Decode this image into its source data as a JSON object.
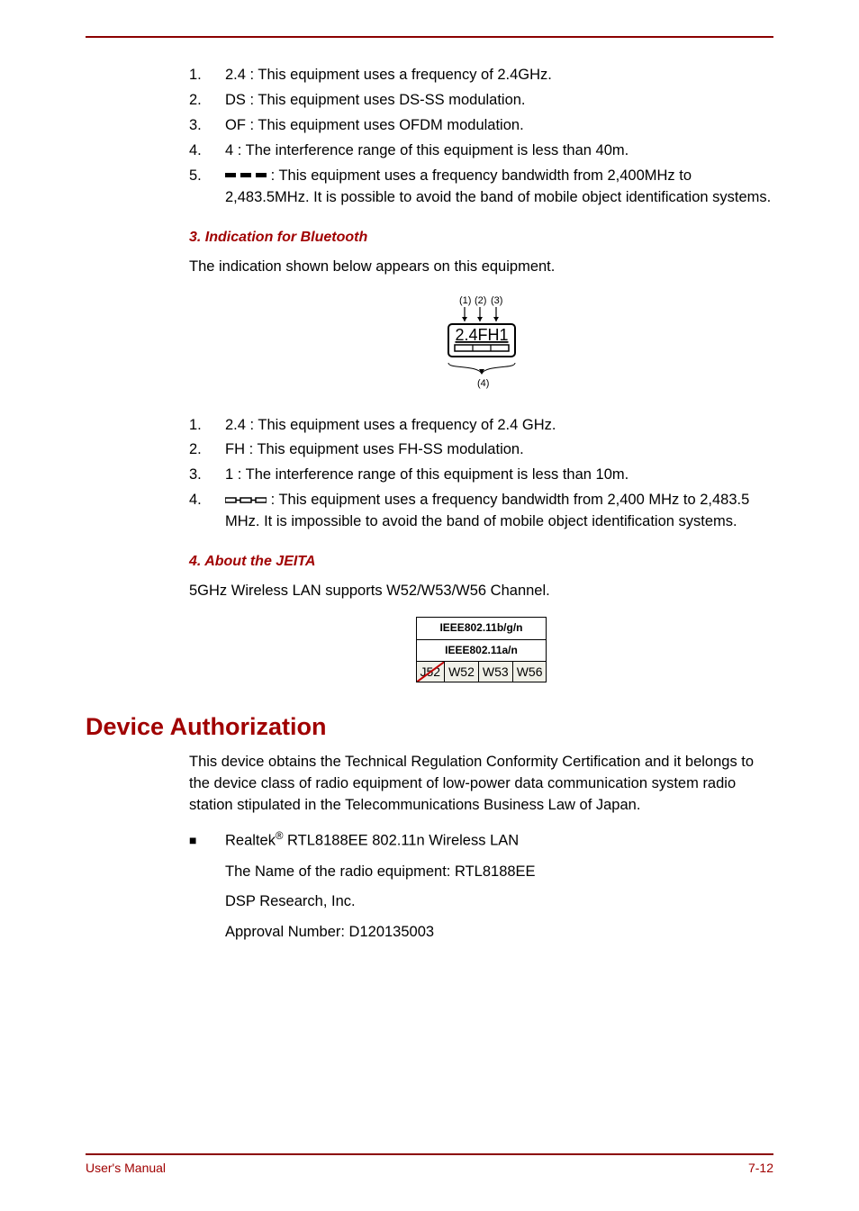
{
  "list_a": [
    {
      "n": "1.",
      "t": "2.4 : This equipment uses a frequency of 2.4GHz."
    },
    {
      "n": "2.",
      "t": "DS : This equipment uses DS-SS modulation."
    },
    {
      "n": "3.",
      "t": "OF : This equipment uses OFDM modulation."
    },
    {
      "n": "4.",
      "t": "4 : The interference range of this equipment is less than 40m."
    },
    {
      "n": "5.",
      "t_after": " : This equipment uses a frequency bandwidth from 2,400MHz to 2,483.5MHz. It is possible to avoid the band of mobile object identification systems."
    }
  ],
  "sect3": {
    "heading": "3. Indication for Bluetooth",
    "para": "The indication shown below appears on this equipment.",
    "fig": {
      "top1": "(1)",
      "top2": "(2)",
      "top3": "(3)",
      "label": "2.4FH1",
      "bottom": "(4)"
    }
  },
  "list_b": [
    {
      "n": "1.",
      "t": "2.4 : This equipment uses a frequency of 2.4 GHz."
    },
    {
      "n": "2.",
      "t": "FH : This equipment uses FH-SS modulation."
    },
    {
      "n": "3.",
      "t": "1 : The interference range of this equipment is less than 10m."
    },
    {
      "n": "4.",
      "t_after": " : This equipment uses a frequency bandwidth from 2,400 MHz to 2,483.5 MHz. It is impossible to avoid the band of mobile object identification systems."
    }
  ],
  "sect4": {
    "heading": "4. About the JEITA",
    "para": "5GHz Wireless LAN supports W52/W53/W56 Channel.",
    "table": {
      "r1": "IEEE802.11b/g/n",
      "r2": "IEEE802.11a/n",
      "c1": "J52",
      "c2": "W52",
      "c3": "W53",
      "c4": "W56"
    }
  },
  "h2": "Device Authorization",
  "auth_para": "This device obtains the Technical Regulation Conformity Certification and it belongs to the device class of radio equipment of low-power data communication system radio station stipulated in the Telecommunications Business Law of Japan.",
  "bullet": {
    "pre": "Realtek",
    "sup": "®",
    "post": " RTL8188EE 802.11n Wireless LAN",
    "sub1": "The Name of the radio equipment: RTL8188EE",
    "sub2": "DSP Research, Inc.",
    "sub3": "Approval Number: D120135003"
  },
  "footer": {
    "left": "User's Manual",
    "right": "7-12"
  }
}
